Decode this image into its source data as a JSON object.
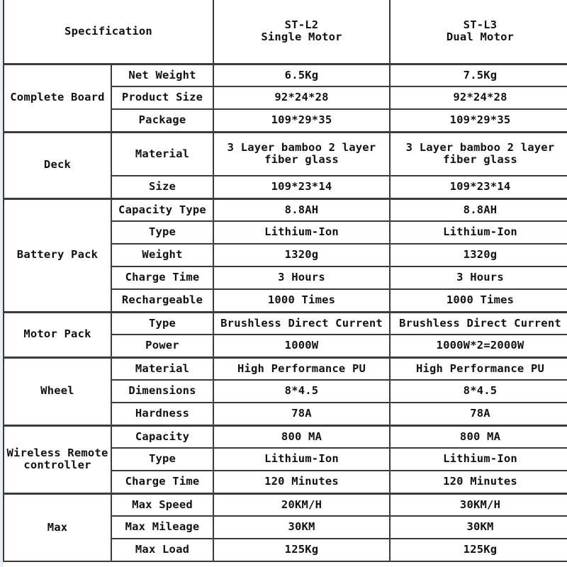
{
  "table": {
    "title": "Specification",
    "columns": [
      {
        "id": "col-spec",
        "label": "Specification"
      },
      {
        "id": "col-l2",
        "model": "ST-L2",
        "variant": "Single Motor",
        "label": "ST-L2\nSingle Motor"
      },
      {
        "id": "col-l3",
        "model": "ST-L3",
        "variant": "Dual Motor",
        "label": "ST-L3\nDual Motor"
      }
    ],
    "groups": [
      {
        "name": "Complete Board",
        "rows": [
          {
            "param": "Net Weight",
            "l2": "6.5Kg",
            "l3": "7.5Kg"
          },
          {
            "param": "Product Size",
            "l2": "92*24*28",
            "l3": "92*24*28"
          },
          {
            "param": "Package",
            "l2": "109*29*35",
            "l3": "109*29*35"
          }
        ]
      },
      {
        "name": "Deck",
        "rows": [
          {
            "param": "Material",
            "l2": "3 Layer bamboo 2 layer\nfiber glass",
            "l3": "3 Layer bamboo 2 layer\nfiber glass",
            "tall": true
          },
          {
            "param": "Size",
            "l2": "109*23*14",
            "l3": "109*23*14"
          }
        ]
      },
      {
        "name": "Battery Pack",
        "rows": [
          {
            "param": "Capacity Type",
            "l2": "8.8AH",
            "l3": "8.8AH"
          },
          {
            "param": "Type",
            "l2": "Lithium-Ion",
            "l3": "Lithium-Ion"
          },
          {
            "param": "Weight",
            "l2": "1320g",
            "l3": "1320g"
          },
          {
            "param": "Charge Time",
            "l2": "3 Hours",
            "l3": "3 Hours"
          },
          {
            "param": "Rechargeable",
            "l2": "1000 Times",
            "l3": "1000 Times"
          }
        ]
      },
      {
        "name": "Motor Pack",
        "rows": [
          {
            "param": "Type",
            "l2": "Brushless Direct Current",
            "l3": "Brushless Direct Current"
          },
          {
            "param": "Power",
            "l2": "1000W",
            "l3": "1000W*2=2000W"
          }
        ]
      },
      {
        "name": "Wheel",
        "rows": [
          {
            "param": "Material",
            "l2": "High Performance PU",
            "l3": "High Performance PU"
          },
          {
            "param": "Dimensions",
            "l2": "8*4.5",
            "l3": "8*4.5"
          },
          {
            "param": "Hardness",
            "l2": "78A",
            "l3": "78A"
          }
        ]
      },
      {
        "name": "Wireless Remote\ncontroller",
        "rows": [
          {
            "param": "Capacity",
            "l2": "800 MA",
            "l3": "800 MA"
          },
          {
            "param": "Type",
            "l2": "Lithium-Ion",
            "l3": "Lithium-Ion"
          },
          {
            "param": "Charge Time",
            "l2": "120 Minutes",
            "l3": "120 Minutes"
          }
        ]
      },
      {
        "name": "Max",
        "rows": [
          {
            "param": "Max Speed",
            "l2": "20KM/H",
            "l3": "30KM/H"
          },
          {
            "param": "Max Mileage",
            "l2": "30KM",
            "l3": "30KM"
          },
          {
            "param": "Max Load",
            "l2": "125Kg",
            "l3": "125Kg"
          }
        ]
      }
    ]
  },
  "colors": {
    "border": "#3c3c3c",
    "text": "#111111",
    "background": "#ffffff",
    "page_edge": "#eaeef6"
  }
}
